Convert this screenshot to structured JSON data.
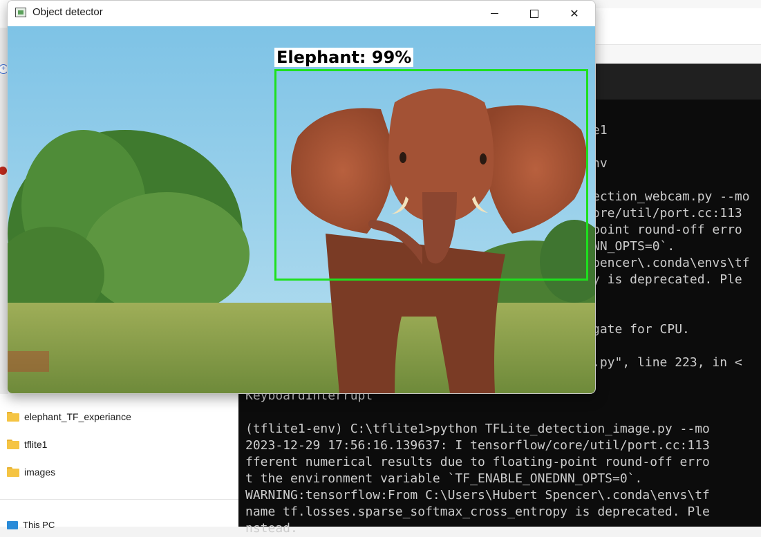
{
  "detector": {
    "title": "Object detector",
    "detection_label": "Elephant: 99%",
    "box_color": "#1ee01e",
    "image_subject": "elephant-photo"
  },
  "explorer": {
    "folders": [
      {
        "name": "elephant_TF_experiance"
      },
      {
        "name": "tflite1"
      },
      {
        "name": "images"
      }
    ],
    "this_pc": "This PC"
  },
  "terminal": {
    "lines": [
      "e1",
      "nv",
      "ection_webcam.py --mo",
      "ore/util/port.cc:113",
      "point round-off erro",
      "NN_OPTS=0`.",
      "pencer\\.conda\\envs\\tf",
      "y is deprecated. Ple",
      "gate for CPU.",
      ".py\", line 223, in <",
      "KeyboardInterrupt",
      "(tflite1-env) C:\\tflite1>python TFLite_detection_image.py --mo",
      "2023-12-29 17:56:16.139637: I tensorflow/core/util/port.cc:113",
      "fferent numerical results due to floating-point round-off erro",
      "t the environment variable `TF_ENABLE_ONEDNN_OPTS=0`.",
      "WARNING:tensorflow:From C:\\Users\\Hubert Spencer\\.conda\\envs\\tf",
      "name tf.losses.sparse_softmax_cross_entropy is deprecated. Ple",
      "nstead."
    ]
  }
}
